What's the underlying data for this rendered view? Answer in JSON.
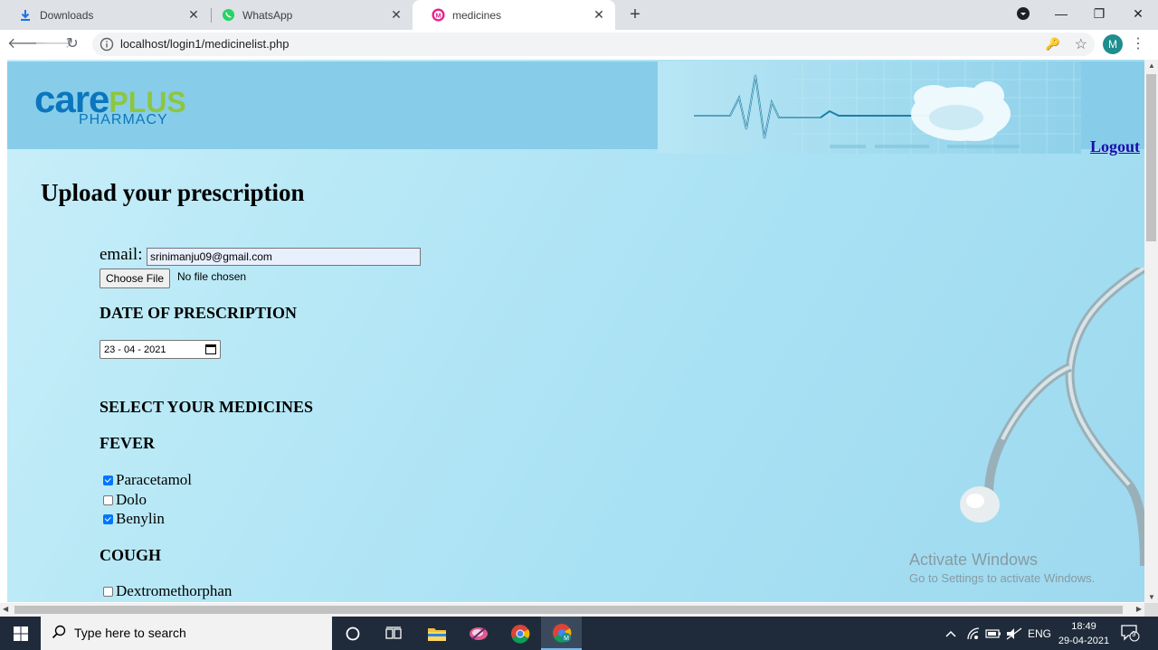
{
  "browser": {
    "tabs": [
      {
        "label": "Downloads",
        "icon": "download-icon",
        "active": false
      },
      {
        "label": "WhatsApp",
        "icon": "whatsapp-icon",
        "active": false
      },
      {
        "label": "medicines",
        "icon": "medicines-favicon",
        "active": true
      }
    ],
    "close_glyph": "✕",
    "url": "localhost/login1/medicinelist.php",
    "avatar_letter": "M"
  },
  "header": {
    "logo_care": "care",
    "logo_plus": "PLUS",
    "logo_sub": "PHARMACY",
    "logout_label": "Logout"
  },
  "form": {
    "title": "Upload your prescription",
    "email_label": "email:",
    "email_value": "srinimanju09@gmail.com",
    "file_button": "Choose File",
    "file_status": "No file chosen",
    "date_heading": "DATE OF PRESCRIPTION",
    "date_value": "23 - 04 - 2021",
    "select_heading": "SELECT YOUR MEDICINES",
    "categories": [
      {
        "name": "FEVER",
        "medicines": [
          {
            "label": "Paracetamol",
            "checked": true
          },
          {
            "label": "Dolo",
            "checked": false
          },
          {
            "label": "Benylin",
            "checked": true
          }
        ]
      },
      {
        "name": "COUGH",
        "medicines": [
          {
            "label": "Dextromethorphan",
            "checked": false
          }
        ]
      }
    ]
  },
  "watermark": {
    "line1": "Activate Windows",
    "line2": "Go to Settings to activate Windows."
  },
  "taskbar": {
    "search_placeholder": "Type here to search",
    "language": "ENG",
    "time": "18:49",
    "date": "29-04-2021",
    "notification_count": "9"
  },
  "colors": {
    "brand_blue": "#0b76bd",
    "brand_green": "#8dc63f",
    "header_blue": "#87cde9",
    "checkbox_blue": "#0075ff"
  }
}
